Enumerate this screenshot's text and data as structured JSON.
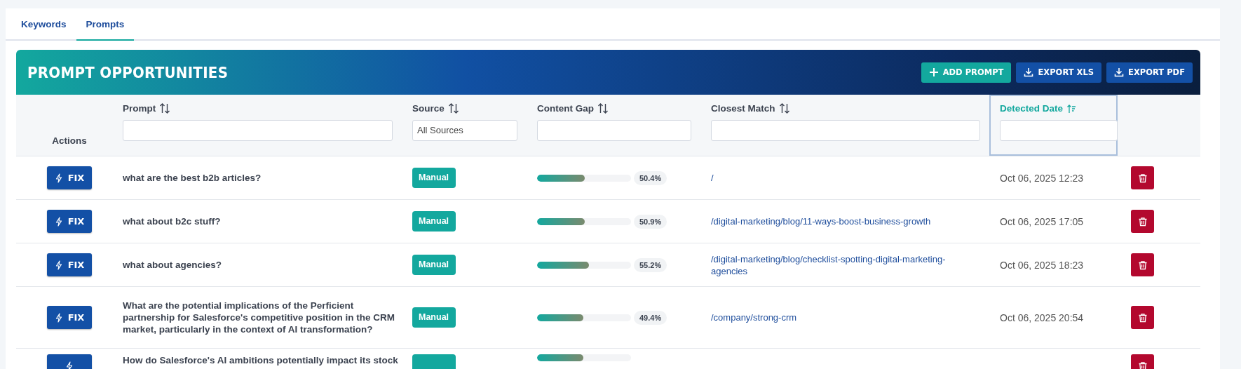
{
  "tabs": [
    {
      "label": "Keywords",
      "selected": false
    },
    {
      "label": "Prompts",
      "selected": true
    }
  ],
  "panel": {
    "title": "PROMPT OPPORTUNITIES",
    "buttons": [
      {
        "label": "ADD PROMPT",
        "kind": "add"
      },
      {
        "label": "EXPORT XLS",
        "kind": "export"
      },
      {
        "label": "EXPORT PDF",
        "kind": "export"
      }
    ]
  },
  "columns": [
    {
      "label": "Actions",
      "kind": "plain"
    },
    {
      "label": "Prompt",
      "kind": "text",
      "sorted": false
    },
    {
      "label": "Source",
      "kind": "select",
      "sorted": false,
      "value": "All Sources"
    },
    {
      "label": "Content Gap",
      "kind": "text",
      "sorted": false
    },
    {
      "label": "Closest Match",
      "kind": "text",
      "sorted": false
    },
    {
      "label": "Detected Date",
      "kind": "text",
      "sorted": true
    },
    {
      "kind": "none"
    }
  ],
  "rows": [
    {
      "action": "FIX",
      "prompt": "what are the best b2b articles?",
      "source": "Manual",
      "level": 0.504,
      "gap": "50.4%",
      "match": "/",
      "date": "Oct 06, 2025 12:23"
    },
    {
      "action": "FIX",
      "prompt": "what about b2c stuff?",
      "source": "Manual",
      "level": 0.509,
      "gap": "50.9%",
      "match": "/digital-marketing/blog/11-ways-boost-business-growth",
      "date": "Oct 06, 2025 17:05"
    },
    {
      "action": "FIX",
      "prompt": "what about agencies?",
      "source": "Manual",
      "level": 0.552,
      "gap": "55.2%",
      "match": "/digital-marketing/blog/checklist-spotting-digital-marketing-agencies",
      "date": "Oct 06, 2025 18:23"
    },
    {
      "action": "FIX",
      "prompt": "What are the potential implications of the Perficient partnership for Salesforce's competitive position in the CRM market, particularly in the context of AI transformation?",
      "source": "Manual",
      "level": 0.494,
      "gap": "49.4%",
      "match": "/company/strong-crm",
      "date": "Oct 06, 2025 20:54"
    },
    {
      "prompt": "How do Salesforce's AI ambitions potentially impact its stock",
      "level": 0.494
    }
  ]
}
